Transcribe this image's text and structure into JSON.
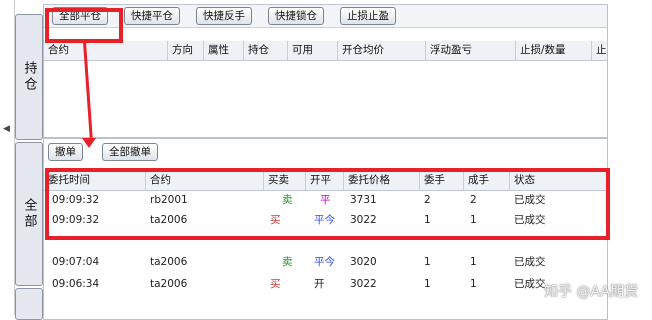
{
  "side_tabs": {
    "positions": "持仓",
    "all": "全部"
  },
  "positions_toolbar": {
    "close_all": "全部平仓",
    "quick_close": "快捷平仓",
    "quick_reverse": "快捷反手",
    "quick_lock": "快捷锁仓",
    "stop_loss_profit": "止损止盈"
  },
  "positions_table": {
    "headers": [
      "合约",
      "方向",
      "属性",
      "持仓",
      "可用",
      "开仓均价",
      "浮动盈亏",
      "止损/数量",
      "止"
    ]
  },
  "orders_toolbar": {
    "cancel": "撤单",
    "cancel_all": "全部撤单"
  },
  "orders_table": {
    "headers": [
      "委托时间",
      "合约",
      "买卖",
      "开平",
      "委托价格",
      "委手",
      "成手",
      "状态"
    ],
    "rows": [
      {
        "time": "09:09:32",
        "contract": "rb2001",
        "side": "卖",
        "side_color": "#1a9a1a",
        "offset": "平",
        "offset_color": "#c000c0",
        "price": "3731",
        "qty": "2",
        "filled": "2",
        "status": "已成交"
      },
      {
        "time": "09:09:32",
        "contract": "ta2006",
        "side": "买",
        "side_color": "#e03030",
        "offset": "平今",
        "offset_color": "#3050e0",
        "price": "3022",
        "qty": "1",
        "filled": "1",
        "status": "已成交"
      },
      {
        "time": "09:07:04",
        "contract": "ta2006",
        "side": "卖",
        "side_color": "#1a9a1a",
        "offset": "平今",
        "offset_color": "#3050e0",
        "price": "3020",
        "qty": "1",
        "filled": "1",
        "status": "已成交"
      },
      {
        "time": "09:06:34",
        "contract": "ta2006",
        "side": "买",
        "side_color": "#e03030",
        "offset": "开",
        "offset_color": "#222222",
        "price": "3022",
        "qty": "1",
        "filled": "1",
        "status": "已成交"
      }
    ]
  },
  "watermark": "知乎 @AA期货"
}
